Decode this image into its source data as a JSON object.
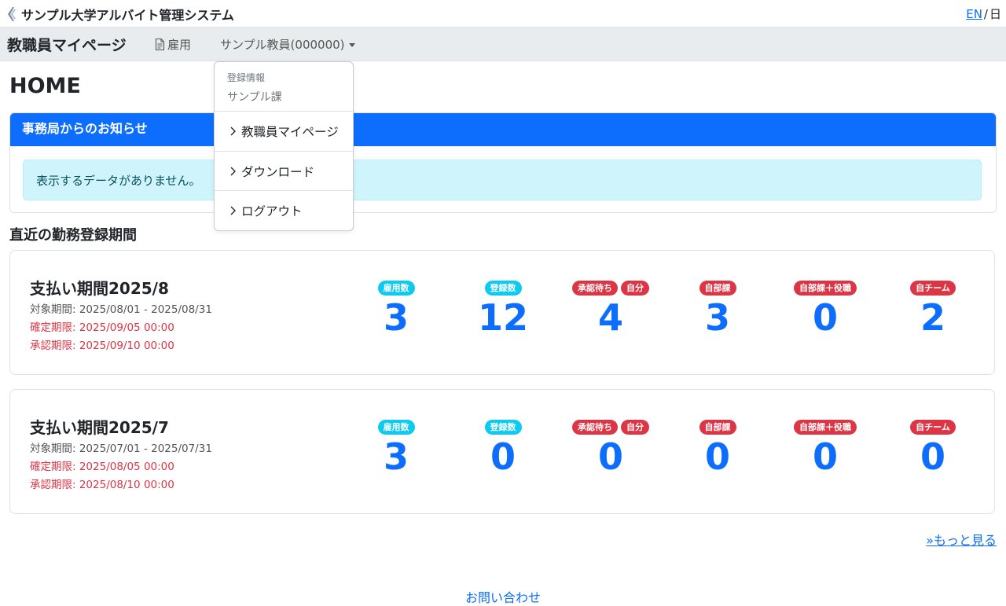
{
  "app": {
    "title": "サンプル大学アルバイト管理システム"
  },
  "lang": {
    "en": "EN",
    "separator": "/",
    "ja": "日"
  },
  "nav": {
    "brand": "教職員マイページ",
    "koyou": "雇用",
    "user": "サンプル教員(000000)"
  },
  "dropdown": {
    "header": "登録情報",
    "dept": "サンプル課",
    "items": [
      "教職員マイページ",
      "ダウンロード",
      "ログアウト"
    ]
  },
  "page": {
    "title": "HOME"
  },
  "notice": {
    "header": "事務局からのお知らせ",
    "empty": "表示するデータがありません。"
  },
  "section": {
    "title": "直近の勤務登録期間"
  },
  "badges": {
    "koyou": "雇用数",
    "touroku": "登録数",
    "shounin": "承認待ち",
    "jibun": "自分",
    "jibuka": "自部課",
    "jibuka_yaku": "自部課＋役職",
    "jiteam": "自チーム"
  },
  "periods": [
    {
      "name": "支払い期間2025/8",
      "range": "対象期間: 2025/08/01 - 2025/08/31",
      "fix": "確定期限: 2025/09/05 00:00",
      "approve": "承認期限: 2025/09/10 00:00",
      "stats": [
        "3",
        "12",
        "4",
        "3",
        "0",
        "2"
      ]
    },
    {
      "name": "支払い期間2025/7",
      "range": "対象期間: 2025/07/01 - 2025/07/31",
      "fix": "確定期限: 2025/08/05 00:00",
      "approve": "承認期限: 2025/08/10 00:00",
      "stats": [
        "3",
        "0",
        "0",
        "0",
        "0",
        "0"
      ]
    }
  ],
  "more": "»もっと見る",
  "footer": {
    "contact": "お問い合わせ"
  },
  "colors": {
    "primary": "#0d6efd",
    "danger": "#dc3545",
    "info": "#0dcaf0"
  }
}
